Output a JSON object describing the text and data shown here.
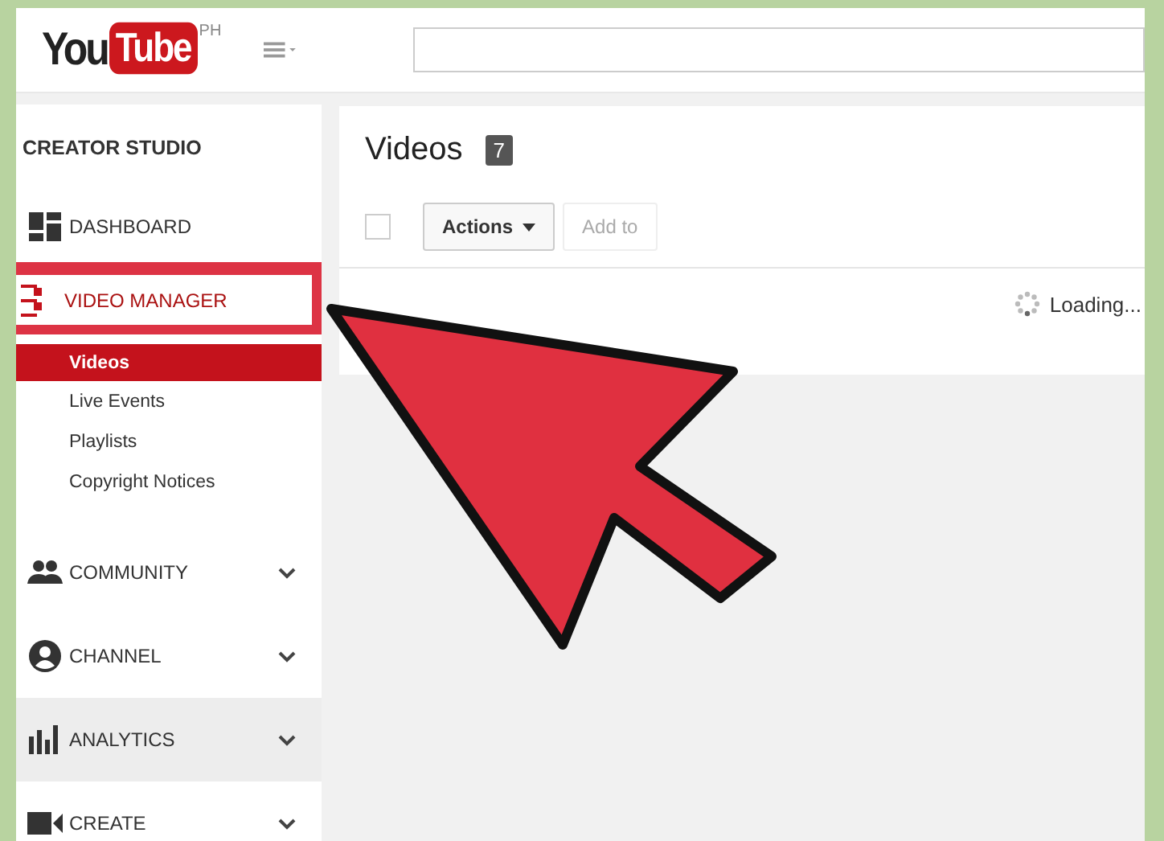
{
  "header": {
    "logo": {
      "you": "You",
      "tube": "Tube",
      "region": "PH"
    }
  },
  "sidebar": {
    "title": "CREATOR STUDIO",
    "items": [
      {
        "label": "DASHBOARD",
        "kind": "link",
        "selected": false
      },
      {
        "label": "VIDEO MANAGER",
        "kind": "group",
        "selected": true,
        "expanded": true,
        "children": [
          {
            "label": "Videos",
            "selected": true
          },
          {
            "label": "Live Events",
            "selected": false
          },
          {
            "label": "Playlists",
            "selected": false
          },
          {
            "label": "Copyright Notices",
            "selected": false
          }
        ]
      },
      {
        "label": "COMMUNITY",
        "kind": "group",
        "selected": false,
        "expanded": false
      },
      {
        "label": "CHANNEL",
        "kind": "group",
        "selected": false,
        "expanded": false
      },
      {
        "label": "ANALYTICS",
        "kind": "group",
        "selected": false,
        "expanded": false,
        "hovered": true
      },
      {
        "label": "CREATE",
        "kind": "group",
        "selected": false,
        "expanded": false
      }
    ]
  },
  "main": {
    "title": "Videos",
    "count": "7",
    "select_all": {
      "checked": false
    },
    "buttons": [
      {
        "label": "Actions",
        "kind": "menu",
        "disabled": false
      },
      {
        "label": "Add to",
        "kind": "plain",
        "disabled": true
      }
    ],
    "status": "Loading..."
  }
}
